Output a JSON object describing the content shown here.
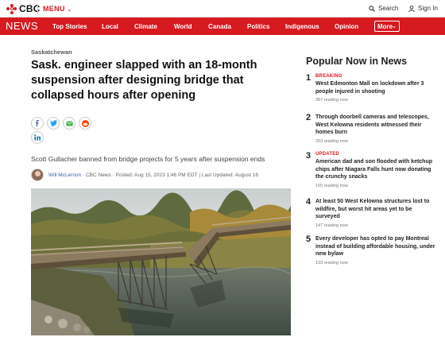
{
  "header": {
    "logo_text": "CBC",
    "menu_label": "MENU",
    "search_label": "Search",
    "signin_label": "Sign In"
  },
  "nav": {
    "brand": "NEWS",
    "items": [
      "Top Stories",
      "Local",
      "Climate",
      "World",
      "Canada",
      "Politics",
      "Indigenous",
      "Opinion"
    ],
    "more_label": "More"
  },
  "article": {
    "section": "Saskatchewan",
    "headline": "Sask. engineer slapped with an 18-month suspension after designing bridge that collapsed hours after opening",
    "subheadline": "Scott Gullacher banned from bridge projects for 5 years after suspension ends",
    "author": "Will McLernon",
    "outlet": "CBC News",
    "posted": "Posted: Aug 15, 2023 1:46 PM EDT",
    "updated": "Last Updated: August 16",
    "share_icons": [
      "facebook-icon",
      "twitter-icon",
      "email-icon",
      "reddit-icon",
      "linkedin-icon"
    ]
  },
  "sidebar": {
    "title": "Popular Now in News",
    "items": [
      {
        "num": "1",
        "badge": "BREAKING",
        "headline": "West Edmonton Mall on lockdown after 3 people injured in shooting",
        "count": "387 reading now"
      },
      {
        "num": "2",
        "badge": "",
        "headline": "Through doorbell cameras and telescopes, West Kelowna residents witnessed their homes burn",
        "count": "263 reading now"
      },
      {
        "num": "3",
        "badge": "UPDATED",
        "headline": "American dad and son flooded with ketchup chips after Niagara Falls hunt now donating the crunchy snacks",
        "count": "165 reading now"
      },
      {
        "num": "4",
        "badge": "",
        "headline": "At least 50 West Kelowna structures lost to wildfire, but worst hit areas yet to be surveyed",
        "count": "147 reading now"
      },
      {
        "num": "5",
        "badge": "",
        "headline": "Every developer has opted to pay Montreal instead of building affordable housing, under new bylaw",
        "count": "133 reading now"
      }
    ]
  },
  "colors": {
    "brand_red": "#d71920",
    "link_blue": "#3a61a8"
  }
}
